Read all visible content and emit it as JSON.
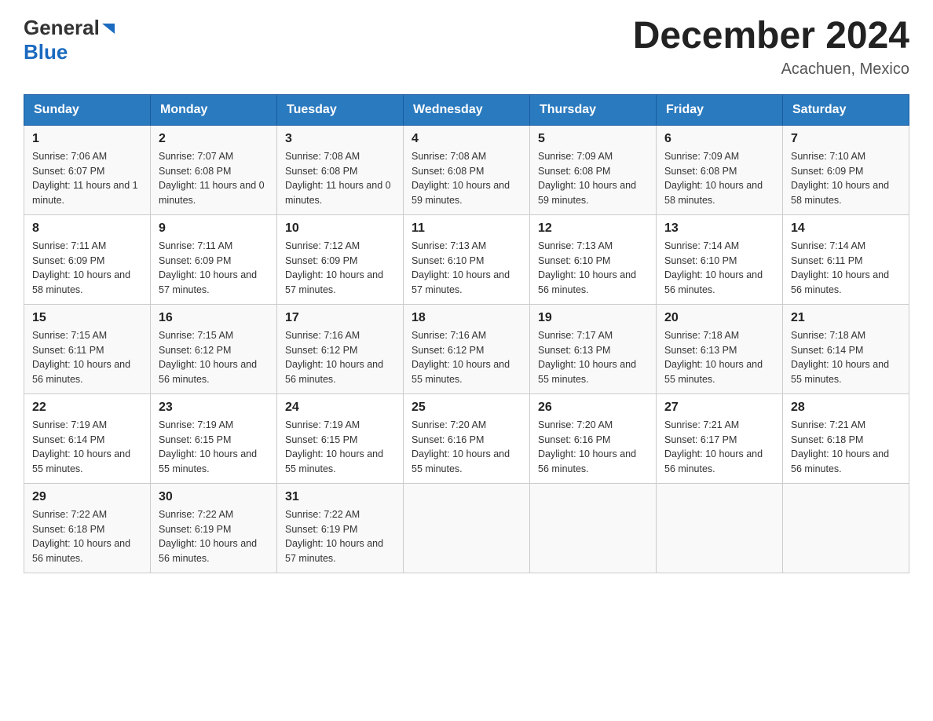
{
  "header": {
    "logo_general": "General",
    "logo_blue": "Blue",
    "month_year": "December 2024",
    "location": "Acachuen, Mexico"
  },
  "days_of_week": [
    "Sunday",
    "Monday",
    "Tuesday",
    "Wednesday",
    "Thursday",
    "Friday",
    "Saturday"
  ],
  "weeks": [
    [
      {
        "day": "1",
        "sunrise": "7:06 AM",
        "sunset": "6:07 PM",
        "daylight": "11 hours and 1 minute."
      },
      {
        "day": "2",
        "sunrise": "7:07 AM",
        "sunset": "6:08 PM",
        "daylight": "11 hours and 0 minutes."
      },
      {
        "day": "3",
        "sunrise": "7:08 AM",
        "sunset": "6:08 PM",
        "daylight": "11 hours and 0 minutes."
      },
      {
        "day": "4",
        "sunrise": "7:08 AM",
        "sunset": "6:08 PM",
        "daylight": "10 hours and 59 minutes."
      },
      {
        "day": "5",
        "sunrise": "7:09 AM",
        "sunset": "6:08 PM",
        "daylight": "10 hours and 59 minutes."
      },
      {
        "day": "6",
        "sunrise": "7:09 AM",
        "sunset": "6:08 PM",
        "daylight": "10 hours and 58 minutes."
      },
      {
        "day": "7",
        "sunrise": "7:10 AM",
        "sunset": "6:09 PM",
        "daylight": "10 hours and 58 minutes."
      }
    ],
    [
      {
        "day": "8",
        "sunrise": "7:11 AM",
        "sunset": "6:09 PM",
        "daylight": "10 hours and 58 minutes."
      },
      {
        "day": "9",
        "sunrise": "7:11 AM",
        "sunset": "6:09 PM",
        "daylight": "10 hours and 57 minutes."
      },
      {
        "day": "10",
        "sunrise": "7:12 AM",
        "sunset": "6:09 PM",
        "daylight": "10 hours and 57 minutes."
      },
      {
        "day": "11",
        "sunrise": "7:13 AM",
        "sunset": "6:10 PM",
        "daylight": "10 hours and 57 minutes."
      },
      {
        "day": "12",
        "sunrise": "7:13 AM",
        "sunset": "6:10 PM",
        "daylight": "10 hours and 56 minutes."
      },
      {
        "day": "13",
        "sunrise": "7:14 AM",
        "sunset": "6:10 PM",
        "daylight": "10 hours and 56 minutes."
      },
      {
        "day": "14",
        "sunrise": "7:14 AM",
        "sunset": "6:11 PM",
        "daylight": "10 hours and 56 minutes."
      }
    ],
    [
      {
        "day": "15",
        "sunrise": "7:15 AM",
        "sunset": "6:11 PM",
        "daylight": "10 hours and 56 minutes."
      },
      {
        "day": "16",
        "sunrise": "7:15 AM",
        "sunset": "6:12 PM",
        "daylight": "10 hours and 56 minutes."
      },
      {
        "day": "17",
        "sunrise": "7:16 AM",
        "sunset": "6:12 PM",
        "daylight": "10 hours and 56 minutes."
      },
      {
        "day": "18",
        "sunrise": "7:16 AM",
        "sunset": "6:12 PM",
        "daylight": "10 hours and 55 minutes."
      },
      {
        "day": "19",
        "sunrise": "7:17 AM",
        "sunset": "6:13 PM",
        "daylight": "10 hours and 55 minutes."
      },
      {
        "day": "20",
        "sunrise": "7:18 AM",
        "sunset": "6:13 PM",
        "daylight": "10 hours and 55 minutes."
      },
      {
        "day": "21",
        "sunrise": "7:18 AM",
        "sunset": "6:14 PM",
        "daylight": "10 hours and 55 minutes."
      }
    ],
    [
      {
        "day": "22",
        "sunrise": "7:19 AM",
        "sunset": "6:14 PM",
        "daylight": "10 hours and 55 minutes."
      },
      {
        "day": "23",
        "sunrise": "7:19 AM",
        "sunset": "6:15 PM",
        "daylight": "10 hours and 55 minutes."
      },
      {
        "day": "24",
        "sunrise": "7:19 AM",
        "sunset": "6:15 PM",
        "daylight": "10 hours and 55 minutes."
      },
      {
        "day": "25",
        "sunrise": "7:20 AM",
        "sunset": "6:16 PM",
        "daylight": "10 hours and 55 minutes."
      },
      {
        "day": "26",
        "sunrise": "7:20 AM",
        "sunset": "6:16 PM",
        "daylight": "10 hours and 56 minutes."
      },
      {
        "day": "27",
        "sunrise": "7:21 AM",
        "sunset": "6:17 PM",
        "daylight": "10 hours and 56 minutes."
      },
      {
        "day": "28",
        "sunrise": "7:21 AM",
        "sunset": "6:18 PM",
        "daylight": "10 hours and 56 minutes."
      }
    ],
    [
      {
        "day": "29",
        "sunrise": "7:22 AM",
        "sunset": "6:18 PM",
        "daylight": "10 hours and 56 minutes."
      },
      {
        "day": "30",
        "sunrise": "7:22 AM",
        "sunset": "6:19 PM",
        "daylight": "10 hours and 56 minutes."
      },
      {
        "day": "31",
        "sunrise": "7:22 AM",
        "sunset": "6:19 PM",
        "daylight": "10 hours and 57 minutes."
      },
      null,
      null,
      null,
      null
    ]
  ]
}
